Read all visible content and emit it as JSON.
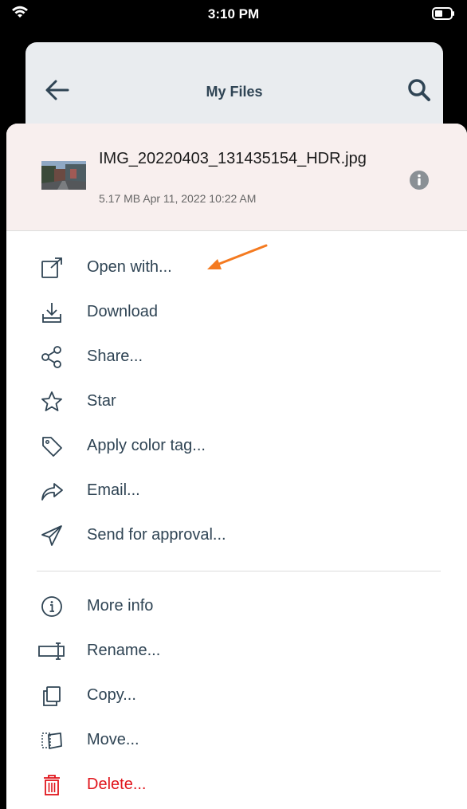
{
  "status_bar": {
    "time": "3:10 PM"
  },
  "header": {
    "title": "My Files"
  },
  "file": {
    "name": "IMG_20220403_131435154_HDR.jpg",
    "meta": "5.17 MB Apr 11, 2022 10:22 AM"
  },
  "menu_group_1": [
    {
      "label": "Open with...",
      "icon": "open-with-icon"
    },
    {
      "label": "Download",
      "icon": "download-icon"
    },
    {
      "label": "Share...",
      "icon": "share-icon"
    },
    {
      "label": "Star",
      "icon": "star-icon"
    },
    {
      "label": "Apply color tag...",
      "icon": "tag-icon"
    },
    {
      "label": "Email...",
      "icon": "email-forward-icon"
    },
    {
      "label": "Send for approval...",
      "icon": "send-icon"
    }
  ],
  "menu_group_2": [
    {
      "label": "More info",
      "icon": "info-icon"
    },
    {
      "label": "Rename...",
      "icon": "rename-icon"
    },
    {
      "label": "Copy...",
      "icon": "copy-icon"
    },
    {
      "label": "Move...",
      "icon": "move-icon"
    },
    {
      "label": "Delete...",
      "icon": "trash-icon"
    }
  ],
  "colors": {
    "text": "#2f4454",
    "danger": "#e0141b",
    "annotation": "#f47a20",
    "header_bg": "#f8efee"
  }
}
